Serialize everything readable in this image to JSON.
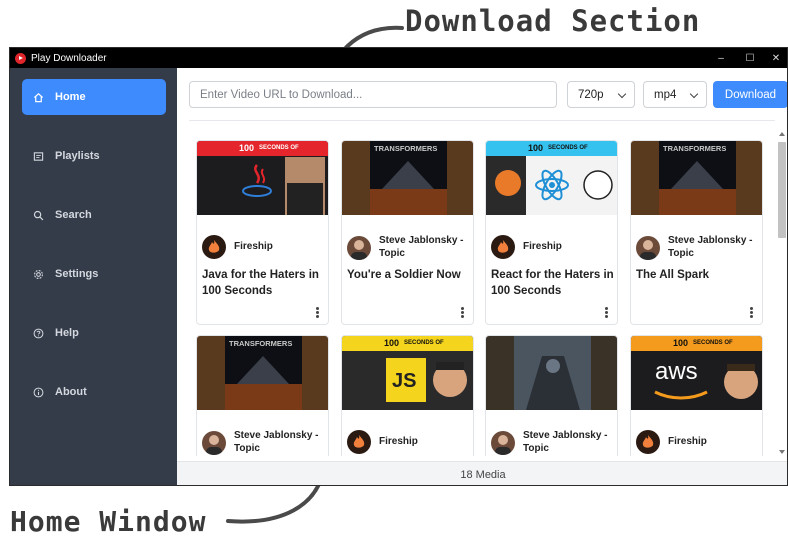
{
  "annotations": {
    "top": "Download Section",
    "bottom": "Home Window"
  },
  "window": {
    "title": "Play Downloader",
    "controls": {
      "minimize": "–",
      "maximize": "☐",
      "close": "✕"
    }
  },
  "sidebar": {
    "items": [
      {
        "label": "Home",
        "icon": "home-icon",
        "active": true
      },
      {
        "label": "Playlists",
        "icon": "playlist-icon",
        "active": false
      },
      {
        "label": "Search",
        "icon": "search-icon",
        "active": false
      },
      {
        "label": "Settings",
        "icon": "gear-icon",
        "active": false
      },
      {
        "label": "Help",
        "icon": "help-icon",
        "active": false
      },
      {
        "label": "About",
        "icon": "info-icon",
        "active": false
      }
    ]
  },
  "download": {
    "url_placeholder": "Enter Video URL to Download...",
    "url_value": "",
    "quality": "720p",
    "format": "mp4",
    "button_label": "Download"
  },
  "thumb_text": {
    "hundred_seconds": "100",
    "seconds_of": "SECONDS OF",
    "transformers": "TRANSFORMERS",
    "js": "JS",
    "aws": "aws"
  },
  "cards": [
    {
      "channel": "Fireship",
      "title": "Java for the Haters in 100 Seconds",
      "avatar": "fire"
    },
    {
      "channel": "Steve Jablonsky - Topic",
      "title": "You're a Soldier Now",
      "avatar": "person"
    },
    {
      "channel": "Fireship",
      "title": "React for the Haters in 100 Seconds",
      "avatar": "fire"
    },
    {
      "channel": "Steve Jablonsky - Topic",
      "title": "The All Spark",
      "avatar": "person"
    },
    {
      "channel": "Steve Jablonsky - Topic",
      "title": "",
      "avatar": "person"
    },
    {
      "channel": "Fireship",
      "title": "",
      "avatar": "fire"
    },
    {
      "channel": "Steve Jablonsky - Topic",
      "title": "",
      "avatar": "person"
    },
    {
      "channel": "Fireship",
      "title": "",
      "avatar": "fire"
    }
  ],
  "footer": {
    "media_count": "18 Media"
  },
  "colors": {
    "accent": "#3d8bfd",
    "sidebar": "#343c4a",
    "titlebar": "#000000"
  }
}
